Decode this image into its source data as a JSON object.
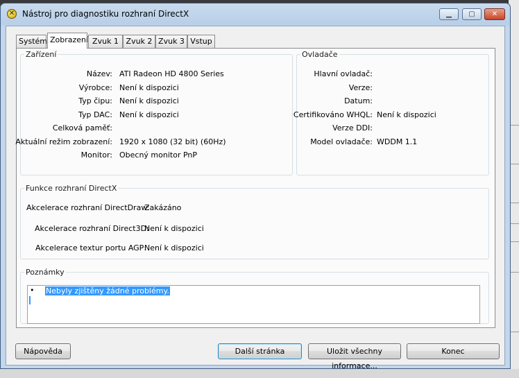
{
  "window": {
    "title": "Nástroj pro diagnostiku rozhraní DirectX"
  },
  "tabs": [
    "Systém",
    "Zobrazení",
    "Zvuk 1",
    "Zvuk 2",
    "Zvuk 3",
    "Vstup"
  ],
  "device": {
    "title": "Zařízení",
    "rows": [
      {
        "label": "Název:",
        "value": "ATI Radeon HD 4800 Series"
      },
      {
        "label": "Výrobce:",
        "value": "Není k dispozici"
      },
      {
        "label": "Typ čipu:",
        "value": "Není k dispozici"
      },
      {
        "label": "Typ DAC:",
        "value": "Není k dispozici"
      },
      {
        "label": "Celková paměť:",
        "value": ""
      },
      {
        "label": "Aktuální režim zobrazení:",
        "value": "1920 x 1080 (32 bit) (60Hz)"
      },
      {
        "label": "Monitor:",
        "value": "Obecný monitor PnP"
      }
    ]
  },
  "drivers": {
    "title": "Ovladače",
    "rows": [
      {
        "label": "Hlavní ovladač:",
        "value": ""
      },
      {
        "label": "Verze:",
        "value": ""
      },
      {
        "label": "Datum:",
        "value": ""
      },
      {
        "label": "Certifikováno WHQL:",
        "value": "Není k dispozici"
      },
      {
        "label": "Verze DDI:",
        "value": ""
      },
      {
        "label": "Model ovladače:",
        "value": "WDDM 1.1"
      }
    ]
  },
  "features": {
    "title": "Funkce rozhraní DirectX",
    "rows": [
      {
        "label": "Akcelerace rozhraní DirectDraw:",
        "value": "Zakázáno"
      },
      {
        "label": "Akcelerace rozhraní Direct3D:",
        "value": "Není k dispozici"
      },
      {
        "label": "Akcelerace textur portu AGP:",
        "value": "Není k dispozici"
      }
    ]
  },
  "notes": {
    "title": "Poznámky",
    "bullet": "•",
    "text": "Nebyly zjištěny žádné problémy."
  },
  "buttons": {
    "help": "Nápověda",
    "next": "Další stránka",
    "save_all": "Uložit všechny informace...",
    "exit": "Konec"
  },
  "colors": {
    "selection": "#3399ff",
    "titlebar": "#c9dbee",
    "close": "#c7452a"
  }
}
